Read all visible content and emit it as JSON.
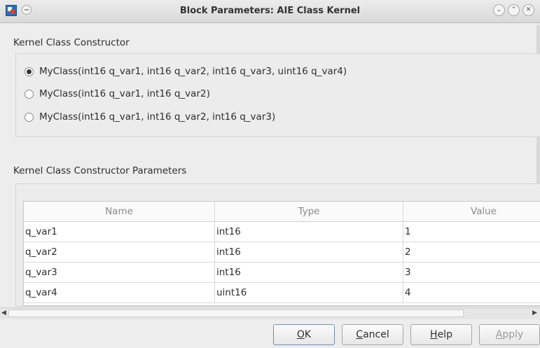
{
  "window": {
    "title": "Block Parameters: AIE Class Kernel"
  },
  "constructor_section": {
    "label": "Kernel Class Constructor",
    "options": [
      {
        "label": "MyClass(int16 q_var1, int16 q_var2, int16 q_var3, uint16 q_var4)",
        "selected": true
      },
      {
        "label": "MyClass(int16 q_var1, int16 q_var2)",
        "selected": false
      },
      {
        "label": "MyClass(int16 q_var1, int16 q_var2, int16 q_var3)",
        "selected": false
      }
    ]
  },
  "parameters_section": {
    "label": "Kernel Class Constructor Parameters",
    "columns": [
      "Name",
      "Type",
      "Value"
    ],
    "rows": [
      [
        "q_var1",
        "int16",
        "1"
      ],
      [
        "q_var2",
        "int16",
        "2"
      ],
      [
        "q_var3",
        "int16",
        "3"
      ],
      [
        "q_var4",
        "uint16",
        "4"
      ]
    ]
  },
  "buttons": {
    "ok": {
      "mnemonic": "O",
      "rest": "K"
    },
    "cancel": {
      "mnemonic": "C",
      "rest": "ancel"
    },
    "help": {
      "mnemonic": "H",
      "rest": "elp"
    },
    "apply": {
      "mnemonic": "A",
      "rest": "pply"
    }
  }
}
